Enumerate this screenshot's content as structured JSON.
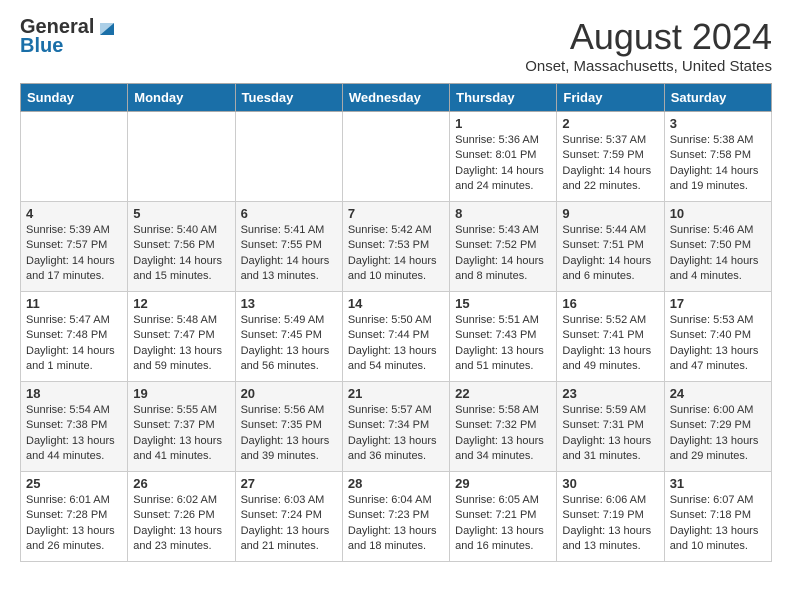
{
  "logo": {
    "general": "General",
    "blue": "Blue"
  },
  "title": "August 2024",
  "location": "Onset, Massachusetts, United States",
  "days_of_week": [
    "Sunday",
    "Monday",
    "Tuesday",
    "Wednesday",
    "Thursday",
    "Friday",
    "Saturday"
  ],
  "weeks": [
    [
      {
        "day": "",
        "info": ""
      },
      {
        "day": "",
        "info": ""
      },
      {
        "day": "",
        "info": ""
      },
      {
        "day": "",
        "info": ""
      },
      {
        "day": "1",
        "info": "Sunrise: 5:36 AM\nSunset: 8:01 PM\nDaylight: 14 hours\nand 24 minutes."
      },
      {
        "day": "2",
        "info": "Sunrise: 5:37 AM\nSunset: 7:59 PM\nDaylight: 14 hours\nand 22 minutes."
      },
      {
        "day": "3",
        "info": "Sunrise: 5:38 AM\nSunset: 7:58 PM\nDaylight: 14 hours\nand 19 minutes."
      }
    ],
    [
      {
        "day": "4",
        "info": "Sunrise: 5:39 AM\nSunset: 7:57 PM\nDaylight: 14 hours\nand 17 minutes."
      },
      {
        "day": "5",
        "info": "Sunrise: 5:40 AM\nSunset: 7:56 PM\nDaylight: 14 hours\nand 15 minutes."
      },
      {
        "day": "6",
        "info": "Sunrise: 5:41 AM\nSunset: 7:55 PM\nDaylight: 14 hours\nand 13 minutes."
      },
      {
        "day": "7",
        "info": "Sunrise: 5:42 AM\nSunset: 7:53 PM\nDaylight: 14 hours\nand 10 minutes."
      },
      {
        "day": "8",
        "info": "Sunrise: 5:43 AM\nSunset: 7:52 PM\nDaylight: 14 hours\nand 8 minutes."
      },
      {
        "day": "9",
        "info": "Sunrise: 5:44 AM\nSunset: 7:51 PM\nDaylight: 14 hours\nand 6 minutes."
      },
      {
        "day": "10",
        "info": "Sunrise: 5:46 AM\nSunset: 7:50 PM\nDaylight: 14 hours\nand 4 minutes."
      }
    ],
    [
      {
        "day": "11",
        "info": "Sunrise: 5:47 AM\nSunset: 7:48 PM\nDaylight: 14 hours\nand 1 minute."
      },
      {
        "day": "12",
        "info": "Sunrise: 5:48 AM\nSunset: 7:47 PM\nDaylight: 13 hours\nand 59 minutes."
      },
      {
        "day": "13",
        "info": "Sunrise: 5:49 AM\nSunset: 7:45 PM\nDaylight: 13 hours\nand 56 minutes."
      },
      {
        "day": "14",
        "info": "Sunrise: 5:50 AM\nSunset: 7:44 PM\nDaylight: 13 hours\nand 54 minutes."
      },
      {
        "day": "15",
        "info": "Sunrise: 5:51 AM\nSunset: 7:43 PM\nDaylight: 13 hours\nand 51 minutes."
      },
      {
        "day": "16",
        "info": "Sunrise: 5:52 AM\nSunset: 7:41 PM\nDaylight: 13 hours\nand 49 minutes."
      },
      {
        "day": "17",
        "info": "Sunrise: 5:53 AM\nSunset: 7:40 PM\nDaylight: 13 hours\nand 47 minutes."
      }
    ],
    [
      {
        "day": "18",
        "info": "Sunrise: 5:54 AM\nSunset: 7:38 PM\nDaylight: 13 hours\nand 44 minutes."
      },
      {
        "day": "19",
        "info": "Sunrise: 5:55 AM\nSunset: 7:37 PM\nDaylight: 13 hours\nand 41 minutes."
      },
      {
        "day": "20",
        "info": "Sunrise: 5:56 AM\nSunset: 7:35 PM\nDaylight: 13 hours\nand 39 minutes."
      },
      {
        "day": "21",
        "info": "Sunrise: 5:57 AM\nSunset: 7:34 PM\nDaylight: 13 hours\nand 36 minutes."
      },
      {
        "day": "22",
        "info": "Sunrise: 5:58 AM\nSunset: 7:32 PM\nDaylight: 13 hours\nand 34 minutes."
      },
      {
        "day": "23",
        "info": "Sunrise: 5:59 AM\nSunset: 7:31 PM\nDaylight: 13 hours\nand 31 minutes."
      },
      {
        "day": "24",
        "info": "Sunrise: 6:00 AM\nSunset: 7:29 PM\nDaylight: 13 hours\nand 29 minutes."
      }
    ],
    [
      {
        "day": "25",
        "info": "Sunrise: 6:01 AM\nSunset: 7:28 PM\nDaylight: 13 hours\nand 26 minutes."
      },
      {
        "day": "26",
        "info": "Sunrise: 6:02 AM\nSunset: 7:26 PM\nDaylight: 13 hours\nand 23 minutes."
      },
      {
        "day": "27",
        "info": "Sunrise: 6:03 AM\nSunset: 7:24 PM\nDaylight: 13 hours\nand 21 minutes."
      },
      {
        "day": "28",
        "info": "Sunrise: 6:04 AM\nSunset: 7:23 PM\nDaylight: 13 hours\nand 18 minutes."
      },
      {
        "day": "29",
        "info": "Sunrise: 6:05 AM\nSunset: 7:21 PM\nDaylight: 13 hours\nand 16 minutes."
      },
      {
        "day": "30",
        "info": "Sunrise: 6:06 AM\nSunset: 7:19 PM\nDaylight: 13 hours\nand 13 minutes."
      },
      {
        "day": "31",
        "info": "Sunrise: 6:07 AM\nSunset: 7:18 PM\nDaylight: 13 hours\nand 10 minutes."
      }
    ]
  ]
}
